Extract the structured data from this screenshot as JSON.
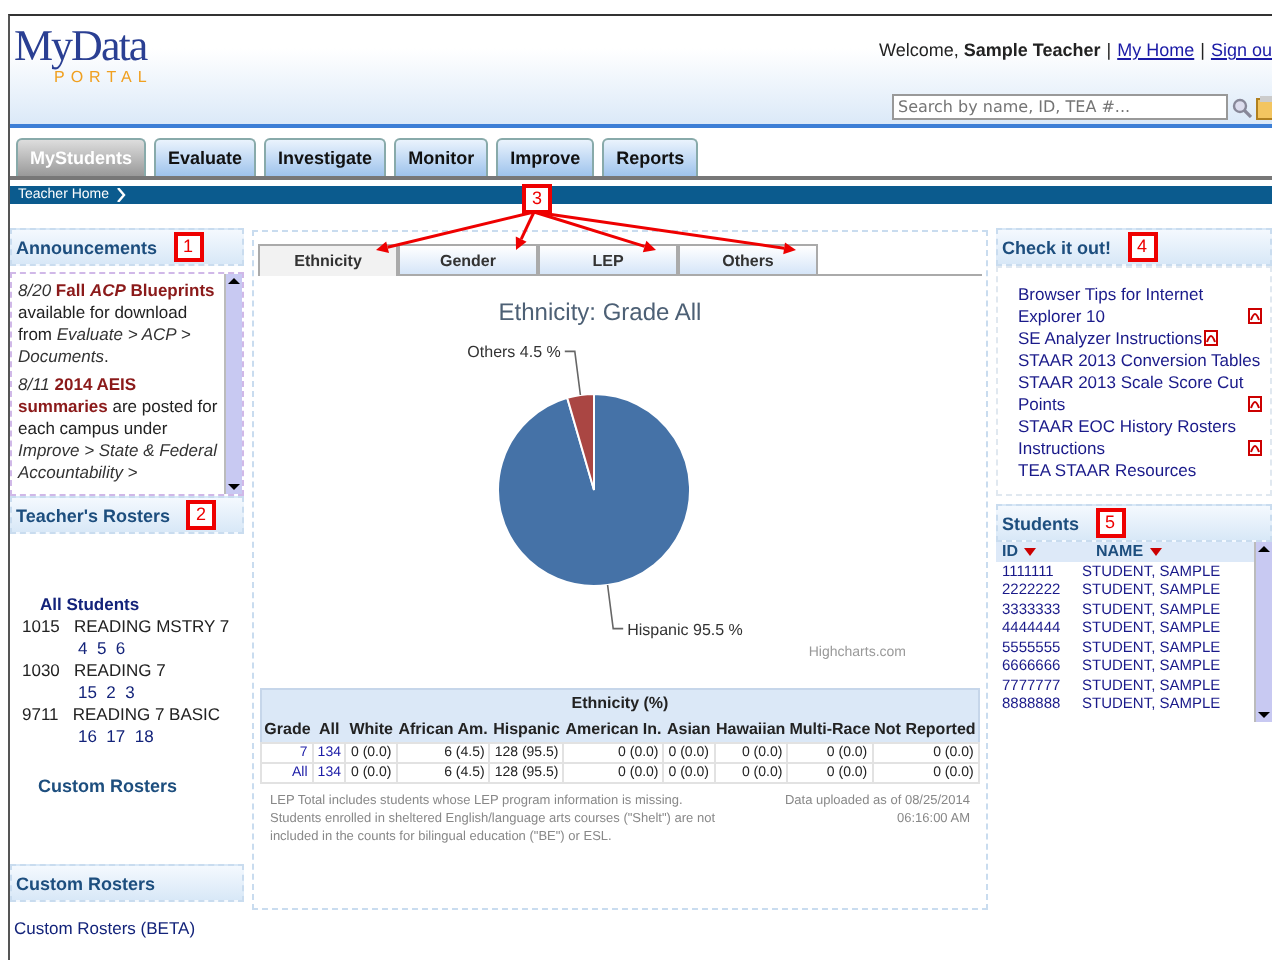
{
  "header": {
    "logo_top": "MyData",
    "logo_bottom": "PORTAL",
    "welcome": "Welcome, **Sample Teacher**",
    "links": [
      "My Home",
      "Sign ou"
    ],
    "separators": [
      "|",
      "|"
    ],
    "search": {
      "placeholder": "Search by name, ID, TEA #..."
    }
  },
  "nav_tabs": [
    {
      "label": "MyStudents",
      "selected": true
    },
    {
      "label": "Evaluate",
      "selected": false
    },
    {
      "label": "Investigate",
      "selected": false
    },
    {
      "label": "Monitor",
      "selected": false
    },
    {
      "label": "Improve",
      "selected": false
    },
    {
      "label": "Reports",
      "selected": false
    }
  ],
  "breadcrumb": "Teacher Home",
  "announcements": {
    "title": "Announcements",
    "callout": "1",
    "items": [
      {
        "text": "*8/20* **Fall *ACP* Blueprints** available for download from *Evaluate > ACP > Documents*."
      },
      {
        "text": "*8/11* **2014 AEIS summaries** are posted for each campus under *Improve > State & Federal Accountability >*"
      }
    ]
  },
  "rosters": {
    "title": "Teacher's Rosters",
    "callout": "2",
    "all": "All Students",
    "items": [
      {
        "code": "1015",
        "name": "READING MSTRY 7",
        "periods": "4  5  6"
      },
      {
        "code": "1030",
        "name": "READING 7",
        "periods": "15  2  3"
      },
      {
        "code": "9711",
        "name": "READING 7 BASIC",
        "periods": "16  17  18"
      }
    ],
    "footer": "Custom Rosters"
  },
  "custom_rosters": {
    "title": "Custom Rosters",
    "link": "Custom Rosters (BETA)"
  },
  "chart_tabs": {
    "callout": "3",
    "tabs": [
      {
        "label": "Ethnicity",
        "selected": true
      },
      {
        "label": "Gender",
        "selected": false
      },
      {
        "label": "LEP",
        "selected": false
      },
      {
        "label": "Others",
        "selected": false
      }
    ]
  },
  "chart": {
    "credit": "Highcharts.com",
    "chart_data": {
      "type": "pie",
      "title": "Ethnicity: Grade All",
      "categories": [
        "Hispanic",
        "Others"
      ],
      "values": [
        95.5,
        4.5
      ],
      "colors": [
        "#4572a7",
        "#aa4643"
      ],
      "value_labels": [
        "95.5 %",
        "4.5 %"
      ]
    }
  },
  "ethnicity_table": {
    "title": "Ethnicity (%)",
    "columns": [
      "Grade",
      "All",
      "White",
      "African Am.",
      "Hispanic",
      "American In.",
      "Asian",
      "Hawaiian",
      "Multi-Race",
      "Not Reported"
    ],
    "rows": [
      [
        "7",
        "134",
        "0 (0.0)",
        "6 (4.5)",
        "128 (95.5)",
        "0 (0.0)",
        "0 (0.0)",
        "0 (0.0)",
        "0 (0.0)",
        "0 (0.0)"
      ],
      [
        "All",
        "134",
        "0 (0.0)",
        "6 (4.5)",
        "128 (95.5)",
        "0 (0.0)",
        "0 (0.0)",
        "0 (0.0)",
        "0 (0.0)",
        "0 (0.0)"
      ]
    ],
    "note": "LEP Total includes students whose LEP program information is missing. Students enrolled in sheltered English/language arts courses (\"Shelt\") are not included in the counts for bilingual education (\"BE\") or ESL.",
    "uploaded": "Data uploaded as of 08/25/2014 06:16:00 AM"
  },
  "check_it_out": {
    "title": "Check it out!",
    "callout": "4",
    "links": [
      {
        "label": "Browser Tips for Internet Explorer 10",
        "pdf": true
      },
      {
        "label": "SE Analyzer Instructions",
        "pdf": true
      },
      {
        "label": "STAAR 2013 Conversion Tables",
        "pdf": false
      },
      {
        "label": "STAAR 2013 Scale Score Cut Points",
        "pdf": true
      },
      {
        "label": "STAAR EOC History Rosters Instructions",
        "pdf": true
      },
      {
        "label": "TEA STAAR Resources",
        "pdf": false
      }
    ]
  },
  "students": {
    "title": "Students",
    "callout": "5",
    "columns": [
      "ID",
      "NAME"
    ],
    "rows": [
      [
        "1111111",
        "STUDENT, SAMPLE"
      ],
      [
        "2222222",
        "STUDENT, SAMPLE"
      ],
      [
        "3333333",
        "STUDENT, SAMPLE"
      ],
      [
        "4444444",
        "STUDENT, SAMPLE"
      ],
      [
        "5555555",
        "STUDENT, SAMPLE"
      ],
      [
        "6666666",
        "STUDENT, SAMPLE"
      ],
      [
        "7777777",
        "STUDENT, SAMPLE"
      ],
      [
        "8888888",
        "STUDENT, SAMPLE"
      ]
    ]
  }
}
